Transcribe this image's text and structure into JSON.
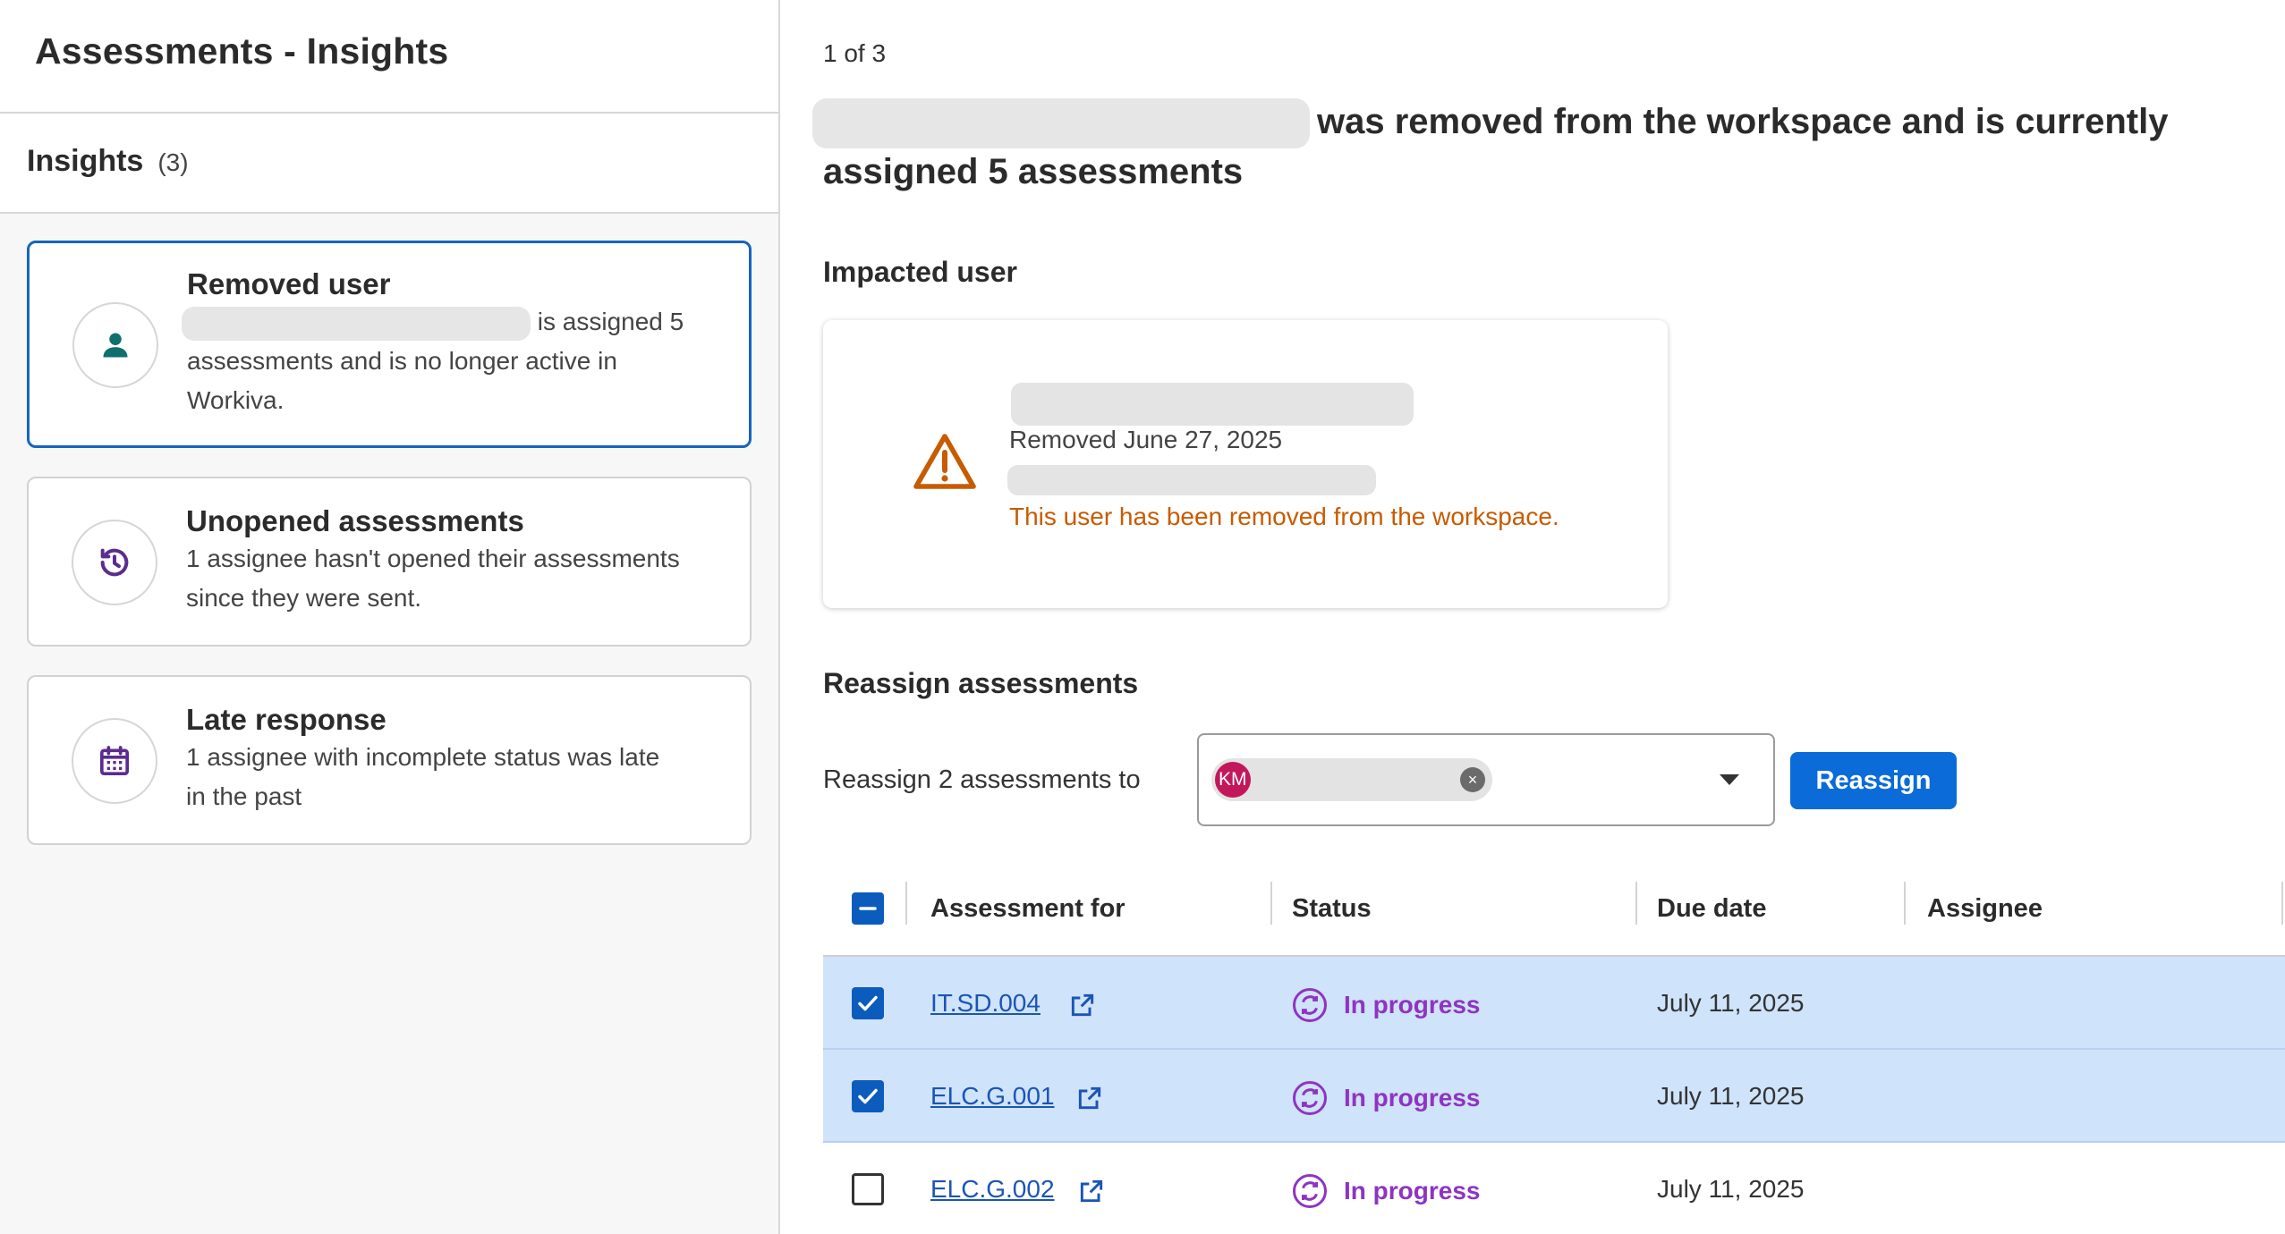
{
  "left": {
    "title": "Assessments - Insights",
    "insights_label": "Insights",
    "insights_count": "(3)",
    "cards": [
      {
        "title": "Removed user",
        "text_after_name": "is assigned 5",
        "text_rest": "assessments and is no longer active in",
        "text_end": "Workiva.",
        "icon": "user-icon"
      },
      {
        "title": "Unopened assessments",
        "text_line1": "1 assignee hasn't opened their assessments",
        "text_line2": "since they were sent.",
        "icon": "history-icon"
      },
      {
        "title": "Late response",
        "text_line1": "1 assignee with incomplete status was late",
        "text_line2": "in the past",
        "icon": "calendar-icon"
      }
    ]
  },
  "right": {
    "pager": "1 of 3",
    "headline_rest": "was removed from the workspace and is currently assigned 5 assessments",
    "impacted_title": "Impacted user",
    "removed_date": "Removed June 27, 2025",
    "removed_msg": "This user has been removed from the workspace.",
    "reassign_title": "Reassign assessments",
    "reassign_label": "Reassign 2 assessments to",
    "chip_initials": "KM",
    "reassign_button": "Reassign"
  },
  "table": {
    "headers": [
      "Assessment for",
      "Status",
      "Due date",
      "Assignee"
    ],
    "rows": [
      {
        "id": "IT.SD.004",
        "status": "In progress",
        "due": "July 11, 2025",
        "selected": true
      },
      {
        "id": "ELC.G.001",
        "status": "In progress",
        "due": "July 11, 2025",
        "selected": true
      },
      {
        "id": "ELC.G.002",
        "status": "In progress",
        "due": "July 11, 2025",
        "selected": false
      }
    ]
  },
  "colors": {
    "accent": "#0b6bd8",
    "selected_row": "#cfe3fb",
    "status": "#8e34c2",
    "warning": "#c75b00",
    "user_icon": "#0f6e6e"
  }
}
